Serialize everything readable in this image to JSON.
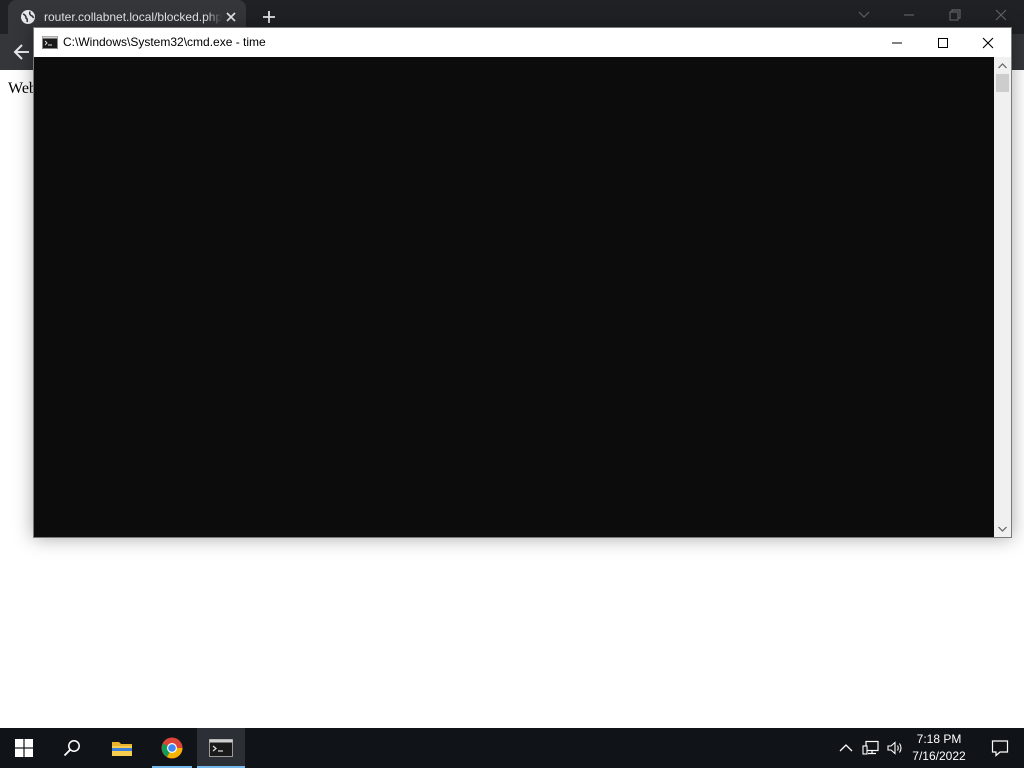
{
  "browser": {
    "tab_title": "router.collabnet.local/blocked.php",
    "page_text": "Web",
    "icons": {
      "tab": "globe-icon",
      "tab_close": "close-icon",
      "new_tab": "plus-icon",
      "back": "back-arrow-icon"
    }
  },
  "cmd_window": {
    "title": "C:\\Windows\\System32\\cmd.exe - time",
    "console_text": "",
    "colors": {
      "console_bg": "#0c0c0c",
      "titlebar_bg": "#ffffff"
    }
  },
  "taskbar": {
    "items": [
      {
        "name": "start",
        "icon": "windows-logo-icon"
      },
      {
        "name": "search",
        "icon": "search-icon"
      },
      {
        "name": "file-explorer",
        "icon": "folder-icon"
      },
      {
        "name": "chrome",
        "icon": "chrome-icon",
        "state": "open"
      },
      {
        "name": "command-prompt",
        "icon": "cmd-icon",
        "state": "active"
      }
    ],
    "clock": {
      "time": "7:18 PM",
      "date": "7/16/2022"
    },
    "accent_color": "#76b9ed"
  }
}
